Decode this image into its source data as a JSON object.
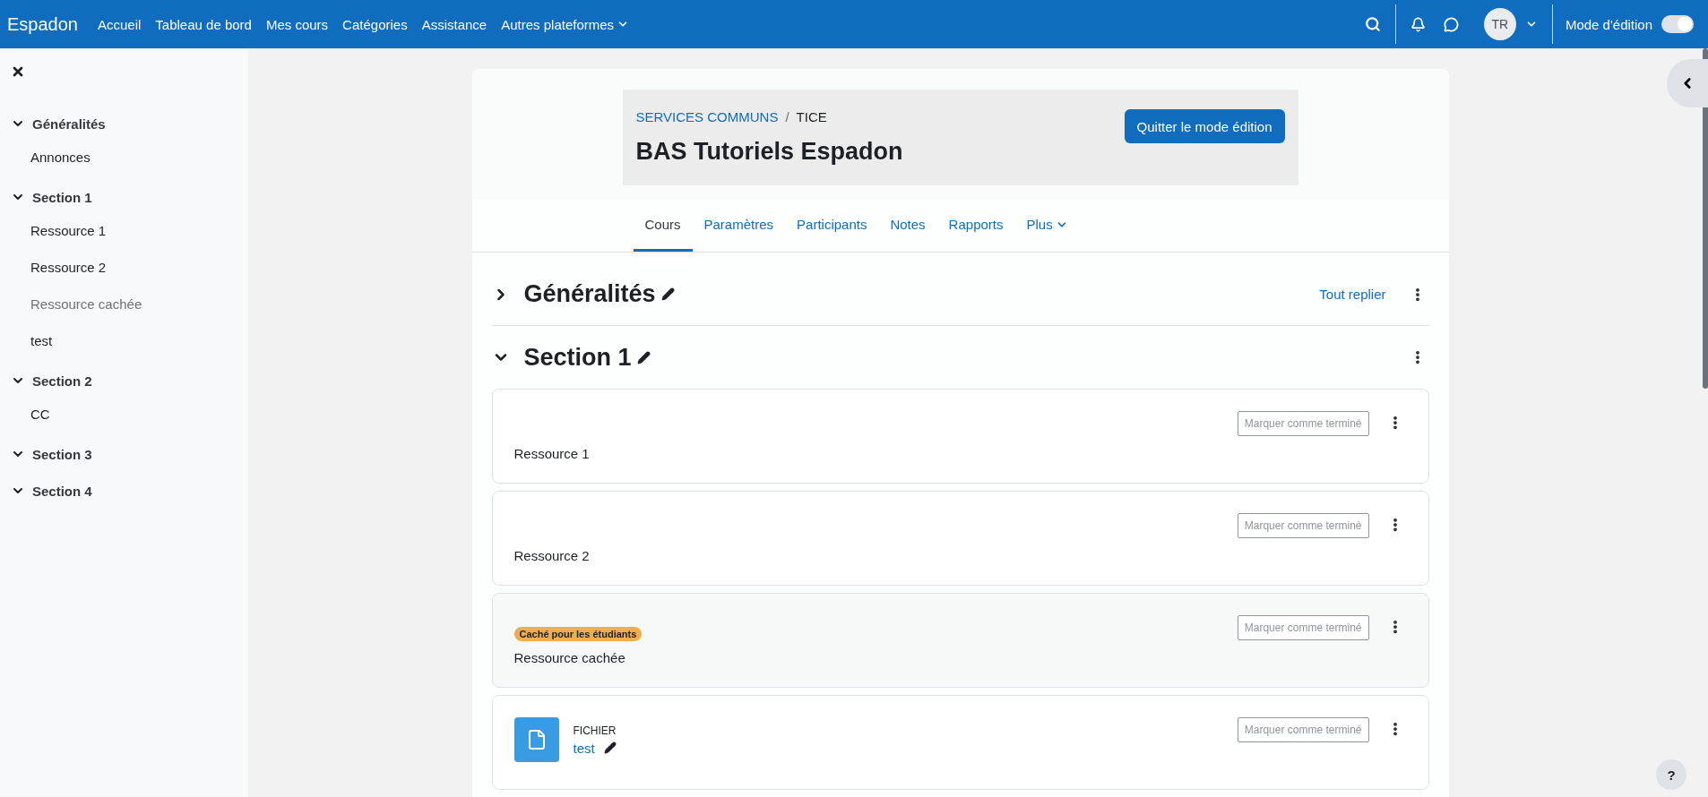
{
  "navbar": {
    "brand": "Espadon",
    "links": [
      {
        "label": "Accueil",
        "dropdown": false
      },
      {
        "label": "Tableau de bord",
        "dropdown": false
      },
      {
        "label": "Mes cours",
        "dropdown": false
      },
      {
        "label": "Catégories",
        "dropdown": false
      },
      {
        "label": "Assistance",
        "dropdown": false
      },
      {
        "label": "Autres plateformes",
        "dropdown": true
      }
    ],
    "avatar": "TR",
    "edit_mode": {
      "label": "Mode d'édition",
      "on": true
    }
  },
  "course_index": [
    {
      "title": "Généralités",
      "expanded": true,
      "items": [
        {
          "label": "Annonces",
          "hidden": false
        }
      ]
    },
    {
      "title": "Section 1",
      "expanded": true,
      "items": [
        {
          "label": "Ressource 1",
          "hidden": false
        },
        {
          "label": "Ressource 2",
          "hidden": false
        },
        {
          "label": "Ressource cachée",
          "hidden": true
        },
        {
          "label": "test",
          "hidden": false
        }
      ]
    },
    {
      "title": "Section 2",
      "expanded": true,
      "items": [
        {
          "label": "CC",
          "hidden": false
        }
      ]
    },
    {
      "title": "Section 3",
      "expanded": true
    },
    {
      "title": "Section 4",
      "expanded": true
    }
  ],
  "header": {
    "breadcrumb": [
      "SERVICES COMMUNS",
      "TICE"
    ],
    "breadcrumb_separator": "/",
    "title": "BAS Tutoriels Espadon",
    "button": "Quitter le mode édition"
  },
  "tabs": [
    {
      "label": "Cours",
      "selected": true,
      "dropdown": false
    },
    {
      "label": "Paramètres",
      "selected": false,
      "dropdown": false
    },
    {
      "label": "Participants",
      "selected": false,
      "dropdown": false
    },
    {
      "label": "Notes",
      "selected": false,
      "dropdown": false
    },
    {
      "label": "Rapports",
      "selected": false,
      "dropdown": false
    },
    {
      "label": "Plus",
      "selected": false,
      "dropdown": true
    }
  ],
  "collapse_all": "Tout replier",
  "sections": [
    {
      "title": "Généralités",
      "expanded": false
    },
    {
      "title": "Section 1",
      "expanded": true,
      "activities": [
        {
          "kind": "label",
          "name": "Ressource 1",
          "hidden": false,
          "completion": "Marquer comme terminé"
        },
        {
          "kind": "label",
          "name": "Ressource 2",
          "hidden": false,
          "completion": "Marquer comme terminé"
        },
        {
          "kind": "label",
          "name": "Ressource cachée",
          "hidden": true,
          "badge": "Caché pour les étudiants",
          "completion": "Marquer comme terminé"
        },
        {
          "kind": "file",
          "type_label": "FICHIER",
          "name": "test",
          "hidden": false,
          "completion": "Marquer comme terminé"
        }
      ]
    }
  ],
  "help_button": "?"
}
